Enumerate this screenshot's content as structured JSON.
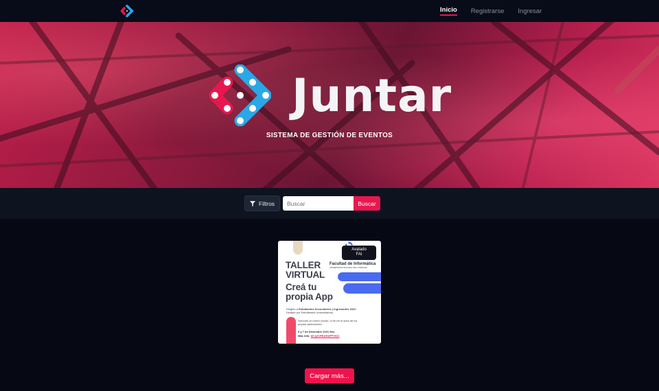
{
  "navbar": {
    "links": [
      {
        "label": "Inicio",
        "active": true
      },
      {
        "label": "Registrarse",
        "active": false
      },
      {
        "label": "Ingresar",
        "active": false
      }
    ]
  },
  "hero": {
    "title": "Juntar",
    "subtitle": "SISTEMA DE GESTIÓN DE EVENTOS"
  },
  "search": {
    "filter_label": "Filtros",
    "placeholder": "Buscar",
    "button_label": "Buscar"
  },
  "events": [
    {
      "badge_line1": "Avalado",
      "badge_line2": "FAI",
      "faculty": "Facultad de Informática",
      "faculty_sub": "UNIVERSIDAD NACIONAL DEL COMAHUE",
      "title_line1": "TALLER",
      "title_line2": "VIRTUAL",
      "headline_line1": "Creá tu",
      "headline_line2": "propia App",
      "audience_prefix": "Dirigido a ",
      "audience": "Estudiantes Secundarios | Ingresantes 2022",
      "dictated_by": "Dictado por Estudiantes Universitarios.",
      "description_line1": "Descubrí un nuevo mundo, el de ser el autor de tus",
      "description_line2": "propias Aplicaciones",
      "dates": "6 y 7 de Diciembre 2021 9hs.",
      "more_info_label": "Más info: ",
      "more_info_link": "bit.ly/CREARAPP2021"
    }
  ],
  "load_more_label": "Cargar más...",
  "colors": {
    "accent": "#e8174f",
    "background": "#060914",
    "logo_pink": "#e8174f",
    "logo_blue": "#29a8e8"
  },
  "icons": {
    "logo": "juntar-logo-icon",
    "filter": "filter-funnel-icon"
  }
}
